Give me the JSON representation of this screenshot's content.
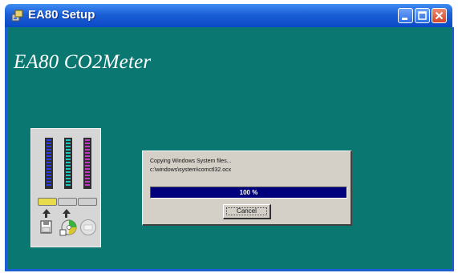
{
  "window": {
    "title": "EA80 Setup",
    "controls": [
      "minimize",
      "maximize",
      "close"
    ]
  },
  "main": {
    "heading": "EA80  CO2Meter"
  },
  "dialog": {
    "status_line": "Copying Windows System files...",
    "file_path": "c:\\windows\\system\\comctl32.ocx",
    "progress_text": "100 %",
    "progress_fraction": 1.0,
    "cancel_label": "Cancel"
  },
  "meter_panel": {
    "bars": [
      {
        "name": "disk-bar",
        "color": "#2a3cf0"
      },
      {
        "name": "cd-bar",
        "color": "#19c6c0"
      },
      {
        "name": "system-bar",
        "color": "#c23ac8"
      }
    ],
    "icons": [
      "floppy-disk-icon",
      "cd-install-icon",
      "computer-icon"
    ]
  },
  "colors": {
    "background": "#0a7771",
    "titlebar": "#1b5fd6",
    "progress": "#00007c",
    "dialog": "#d4d0c8"
  }
}
